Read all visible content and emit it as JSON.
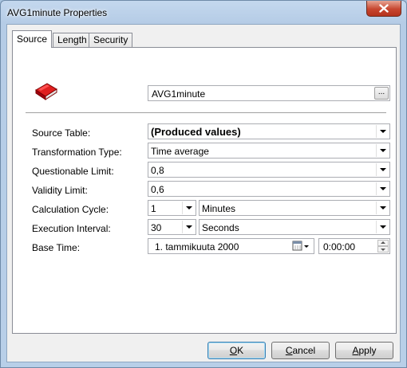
{
  "window": {
    "title": "AVG1minute Properties"
  },
  "tabs": [
    {
      "label": "Source",
      "active": true
    },
    {
      "label": "Length",
      "active": false
    },
    {
      "label": "Security",
      "active": false
    }
  ],
  "header": {
    "icon": "book-icon",
    "name_value": "AVG1minute",
    "browse_label": "..."
  },
  "fields": {
    "source_table": {
      "label": "Source Table:",
      "value": "(Produced values)"
    },
    "transformation_type": {
      "label": "Transformation Type:",
      "value": "Time average"
    },
    "questionable_limit": {
      "label": "Questionable Limit:",
      "value": "0,8"
    },
    "validity_limit": {
      "label": "Validity Limit:",
      "value": "0,6"
    },
    "calculation_cycle": {
      "label": "Calculation Cycle:",
      "number": "1",
      "unit": "Minutes"
    },
    "execution_interval": {
      "label": "Execution Interval:",
      "number": "30",
      "unit": "Seconds"
    },
    "base_time": {
      "label": "Base Time:",
      "date": "1. tammikuuta 2000",
      "time": "0:00:00"
    }
  },
  "buttons": {
    "ok": {
      "first": "O",
      "rest": "K"
    },
    "cancel": {
      "first": "C",
      "rest": "ancel"
    },
    "apply": {
      "first": "A",
      "rest": "pply"
    }
  },
  "colors": {
    "book_red": "#c8102e",
    "title_bar": "#b9d1ea",
    "close_red": "#c7462f"
  }
}
